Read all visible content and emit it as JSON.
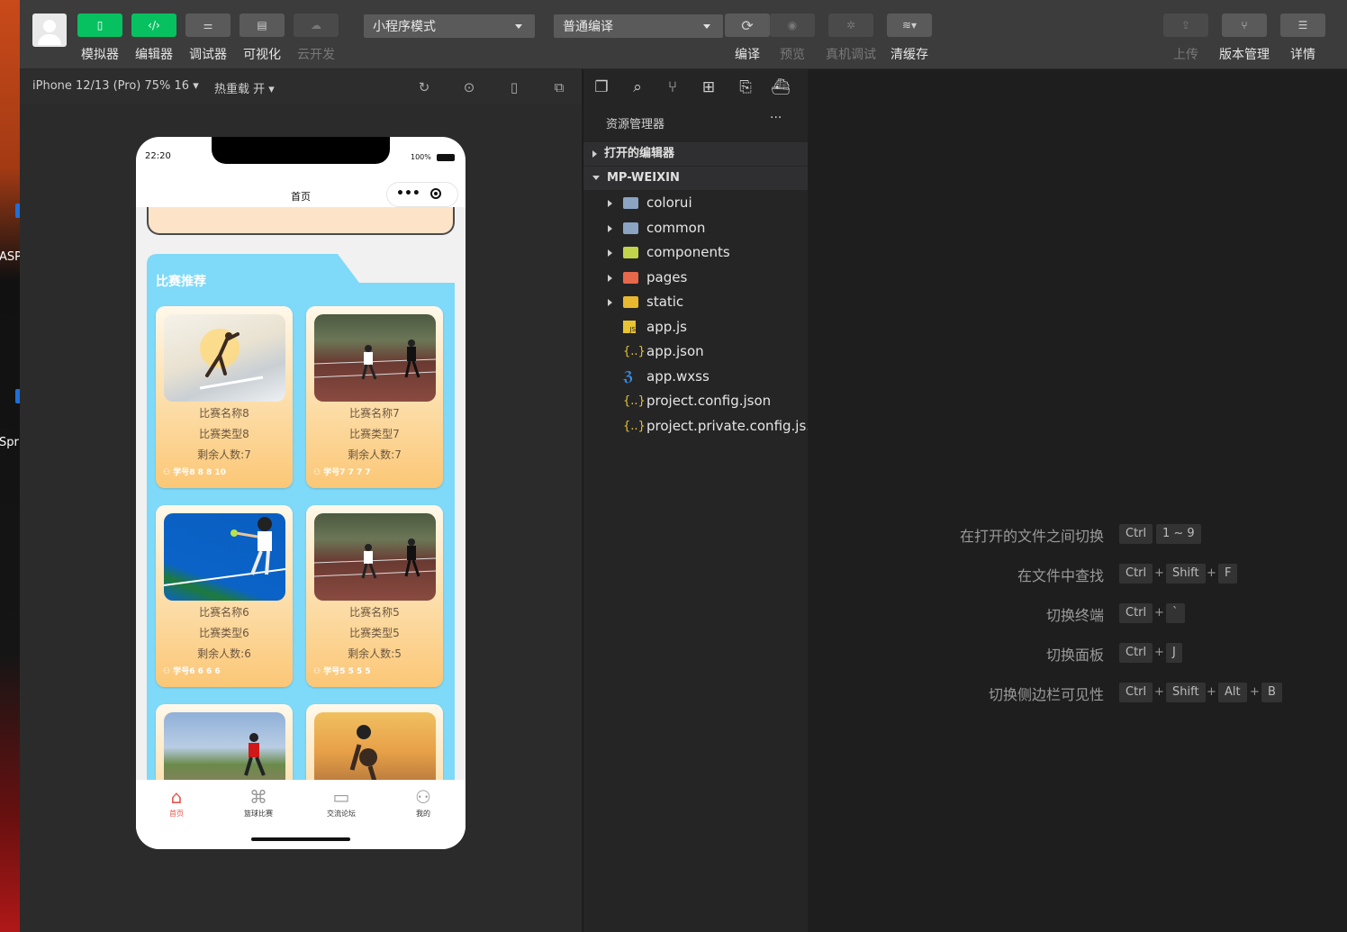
{
  "desktop": {
    "labels": [
      "ASP",
      "Spri"
    ]
  },
  "toolbar": {
    "left_buttons": [
      {
        "label": "模拟器",
        "icon": "phone-icon",
        "active": true
      },
      {
        "label": "编辑器",
        "icon": "code-icon",
        "active": true
      },
      {
        "label": "调试器",
        "icon": "debugger-icon",
        "active": false
      },
      {
        "label": "可视化",
        "icon": "layout-icon",
        "active": false
      },
      {
        "label": "云开发",
        "icon": "cloud-icon",
        "active": false,
        "disabled": true
      }
    ],
    "mode_select": "小程序模式",
    "compile_select": "普通编译",
    "mid_buttons": [
      {
        "label": "编译",
        "icon": "refresh-icon"
      },
      {
        "label": "预览",
        "icon": "eye-icon",
        "disabled": true
      },
      {
        "label": "真机调试",
        "icon": "bug-icon",
        "disabled": true
      },
      {
        "label": "清缓存",
        "icon": "layers-icon"
      }
    ],
    "right_buttons": [
      {
        "label": "上传",
        "icon": "upload-icon",
        "disabled": true
      },
      {
        "label": "版本管理",
        "icon": "branch-icon"
      },
      {
        "label": "详情",
        "icon": "menu-icon"
      }
    ]
  },
  "simulator": {
    "device": "iPhone 12/13 (Pro) 75% 16",
    "hot_reload": "热重载 开"
  },
  "phone": {
    "time": "22:20",
    "battery": "100%",
    "nav_title": "首页",
    "section_title": "比赛推荐",
    "cards": [
      {
        "name": "比赛名称8",
        "type": "比赛类型8",
        "remain": "剩余人数:7",
        "meta": "学号8  8  8  10"
      },
      {
        "name": "比赛名称7",
        "type": "比赛类型7",
        "remain": "剩余人数:7",
        "meta": "学号7  7  7  7"
      },
      {
        "name": "比赛名称6",
        "type": "比赛类型6",
        "remain": "剩余人数:6",
        "meta": "学号6  6  6  6"
      },
      {
        "name": "比赛名称5",
        "type": "比赛类型5",
        "remain": "剩余人数:5",
        "meta": "学号5  5  5  5"
      }
    ],
    "tabs": [
      {
        "label": "首页",
        "active": true
      },
      {
        "label": "篮球比赛",
        "active": false
      },
      {
        "label": "交流论坛",
        "active": false
      },
      {
        "label": "我的",
        "active": false
      }
    ]
  },
  "explorer": {
    "title": "资源管理器",
    "more": "···",
    "open_editors": "打开的编辑器",
    "project": "MP-WEIXIN",
    "items": [
      {
        "name": "colorui",
        "kind": "folder"
      },
      {
        "name": "common",
        "kind": "folder"
      },
      {
        "name": "components",
        "kind": "folder-components"
      },
      {
        "name": "pages",
        "kind": "folder-pages"
      },
      {
        "name": "static",
        "kind": "folder-static"
      },
      {
        "name": "app.js",
        "kind": "js"
      },
      {
        "name": "app.json",
        "kind": "json"
      },
      {
        "name": "app.wxss",
        "kind": "css"
      },
      {
        "name": "project.config.json",
        "kind": "json"
      },
      {
        "name": "project.private.config.js...",
        "kind": "json"
      }
    ]
  },
  "shortcuts": [
    {
      "name": "在打开的文件之间切换",
      "keys": [
        "Ctrl",
        "1 ~ 9"
      ],
      "plus": false
    },
    {
      "name": "在文件中查找",
      "keys": [
        "Ctrl",
        "Shift",
        "F"
      ],
      "plus": true
    },
    {
      "name": "切换终端",
      "keys": [
        "Ctrl",
        "`"
      ],
      "plus": true
    },
    {
      "name": "切换面板",
      "keys": [
        "Ctrl",
        "J"
      ],
      "plus": true
    },
    {
      "name": "切换侧边栏可见性",
      "keys": [
        "Ctrl",
        "Shift",
        "Alt",
        "B"
      ],
      "plus": true
    }
  ],
  "colors": {
    "accent": "#07c160",
    "card_bg": "#7fd9f8",
    "tab_active": "#e8554e"
  }
}
